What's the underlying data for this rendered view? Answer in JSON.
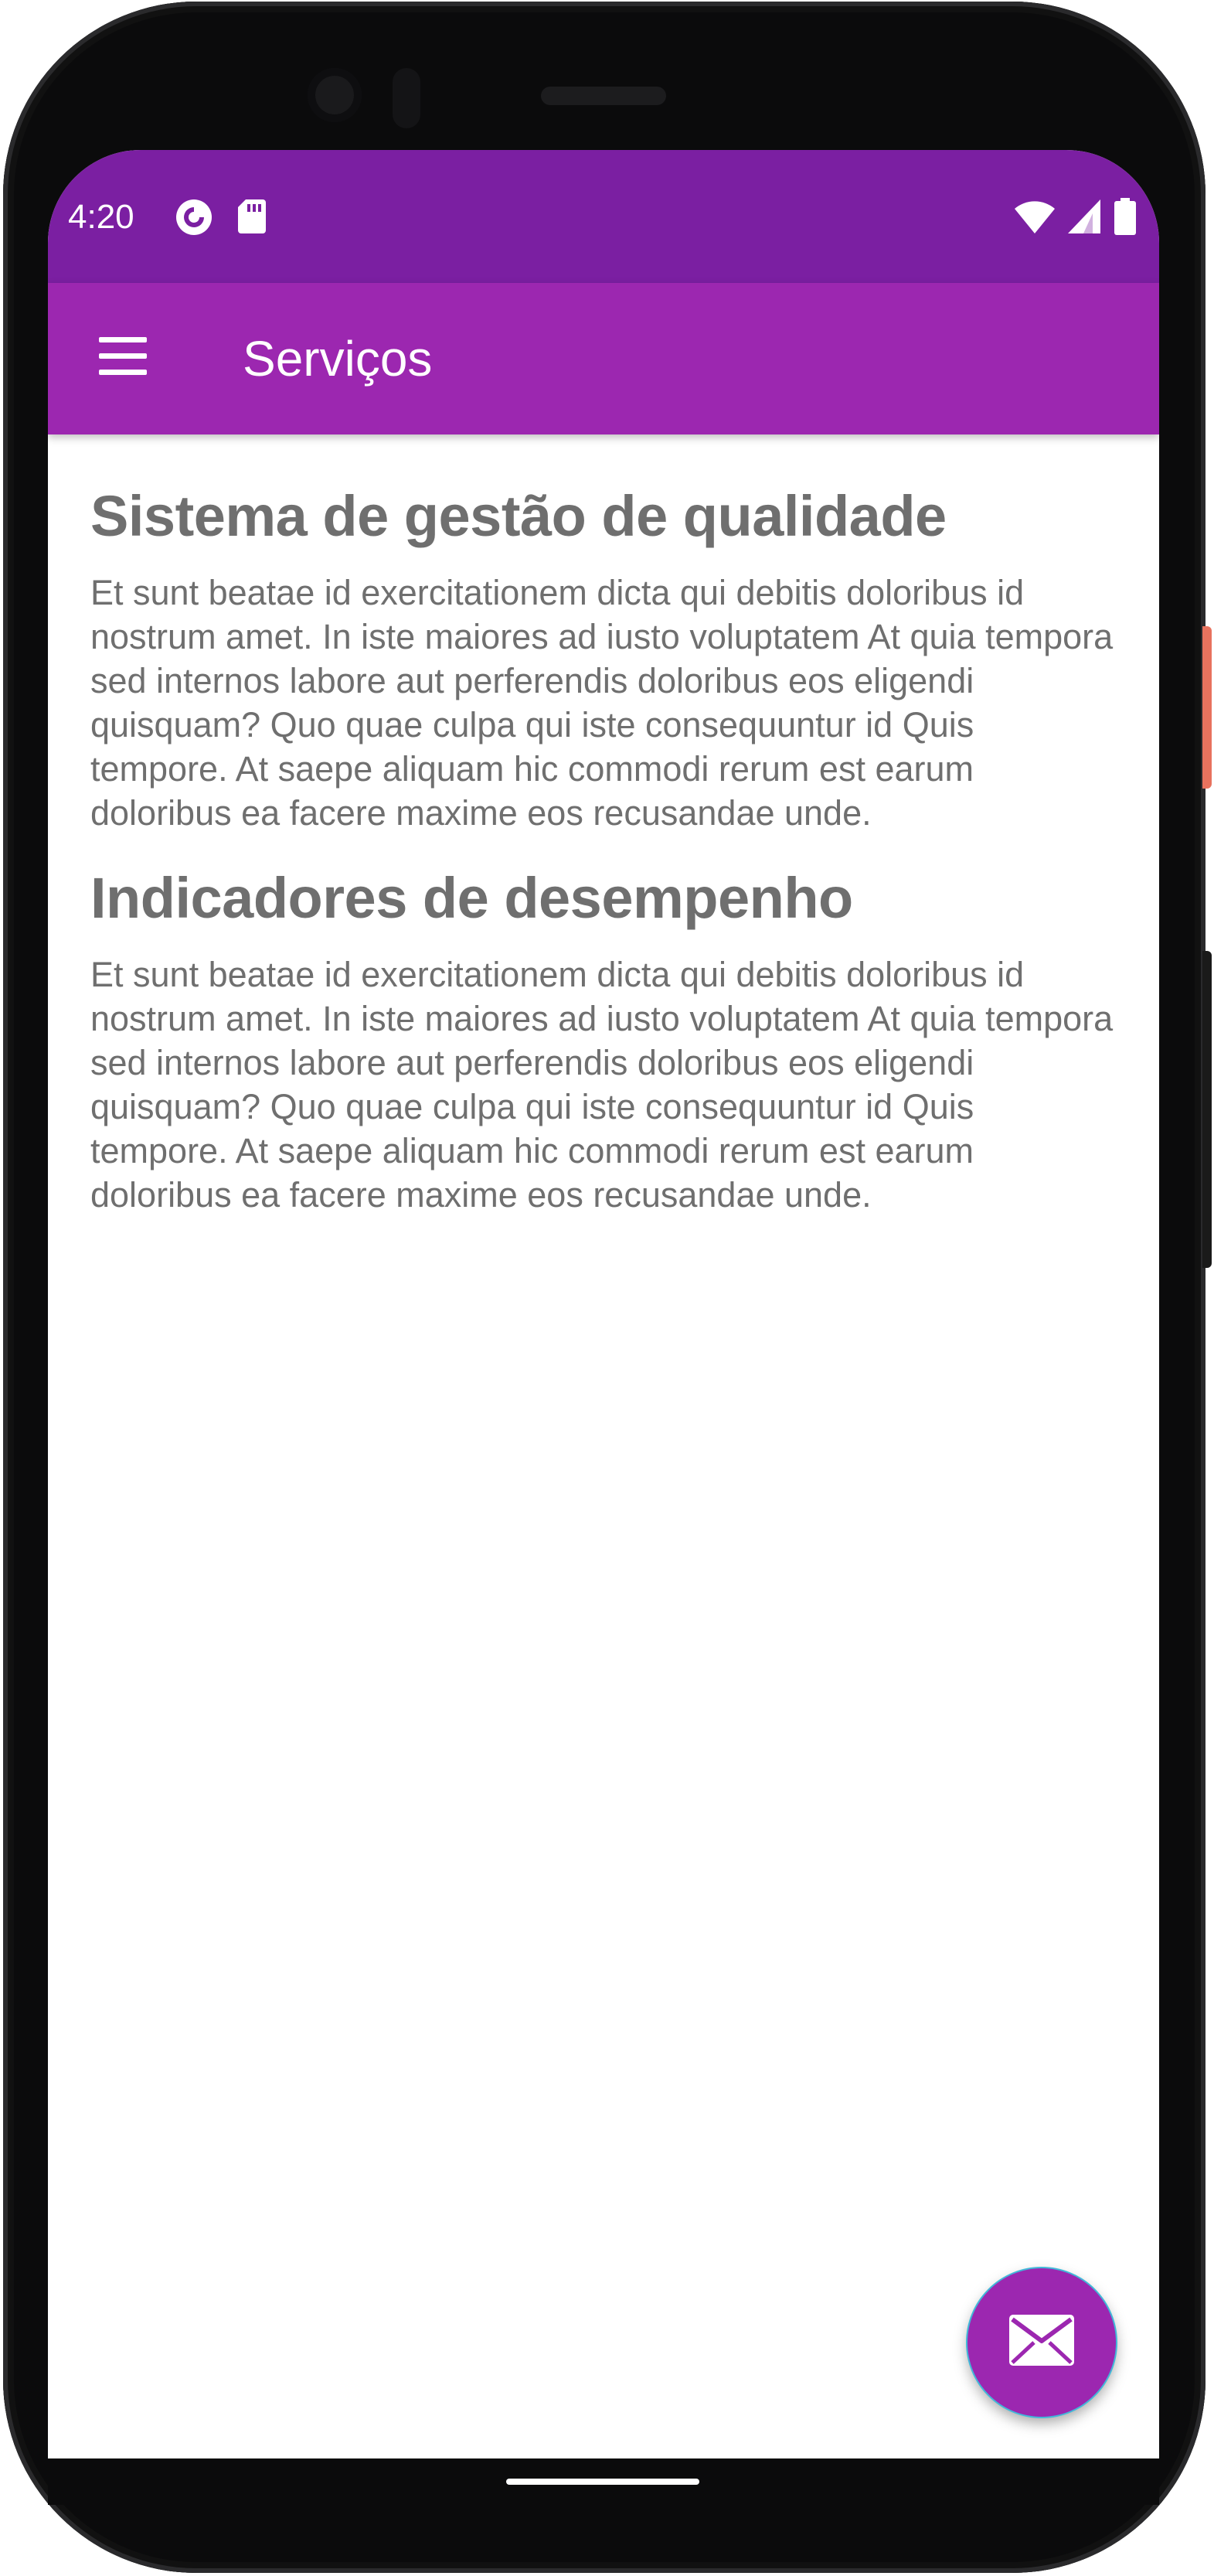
{
  "status_bar": {
    "time": "4:20",
    "icons": [
      "pocket-casts-notification-icon",
      "sd-card-icon",
      "wifi-icon",
      "cell-signal-icon",
      "battery-icon"
    ]
  },
  "app_bar": {
    "menu_icon": "hamburger-menu-icon",
    "title": "Serviços"
  },
  "sections": [
    {
      "heading": "Sistema de gestão de qualidade",
      "body": "Et sunt beatae id exercitationem dicta qui debitis doloribus id nostrum amet. In iste maiores ad iusto voluptatem At quia tempora sed internos labore aut perferendis doloribus eos eligendi quisquam? Quo quae culpa qui iste consequuntur id Quis tempore. At saepe aliquam hic commodi rerum est earum doloribus ea facere maxime eos recusandae unde."
    },
    {
      "heading": "Indicadores de desempenho",
      "body": "Et sunt beatae id exercitationem dicta qui debitis doloribus id nostrum amet. In iste maiores ad iusto voluptatem At quia tempora sed internos labore aut perferendis doloribus eos eligendi quisquam? Quo quae culpa qui iste consequuntur id Quis tempore. At saepe aliquam hic commodi rerum est earum doloribus ea facere maxime eos recusandae unde."
    }
  ],
  "fab": {
    "icon": "mail-icon"
  },
  "colors": {
    "status_bar": "#7b1fa2",
    "app_bar": "#9c27b0",
    "text": "#6f6f6f",
    "fab": "#9c27b0"
  }
}
